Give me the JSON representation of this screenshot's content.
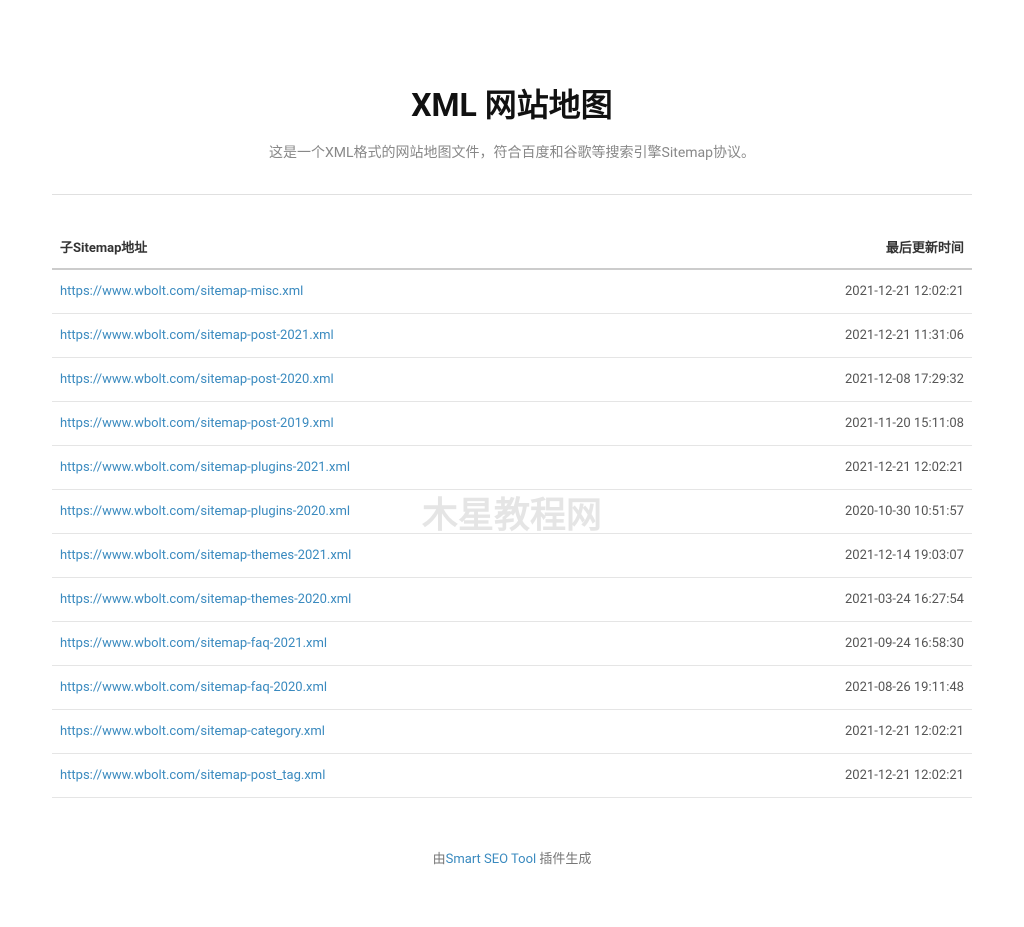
{
  "header": {
    "title": "XML 网站地图",
    "description": "这是一个XML格式的网站地图文件，符合百度和谷歌等搜索引擎Sitemap协议。"
  },
  "table": {
    "col_url_label": "子Sitemap地址",
    "col_date_label": "最后更新时间",
    "rows": [
      {
        "url": "https://www.wbolt.com/sitemap-misc.xml",
        "date": "2021-12-21 12:02:21"
      },
      {
        "url": "https://www.wbolt.com/sitemap-post-2021.xml",
        "date": "2021-12-21 11:31:06"
      },
      {
        "url": "https://www.wbolt.com/sitemap-post-2020.xml",
        "date": "2021-12-08 17:29:32"
      },
      {
        "url": "https://www.wbolt.com/sitemap-post-2019.xml",
        "date": "2021-11-20 15:11:08"
      },
      {
        "url": "https://www.wbolt.com/sitemap-plugins-2021.xml",
        "date": "2021-12-21 12:02:21"
      },
      {
        "url": "https://www.wbolt.com/sitemap-plugins-2020.xml",
        "date": "2020-10-30 10:51:57"
      },
      {
        "url": "https://www.wbolt.com/sitemap-themes-2021.xml",
        "date": "2021-12-14 19:03:07"
      },
      {
        "url": "https://www.wbolt.com/sitemap-themes-2020.xml",
        "date": "2021-03-24 16:27:54"
      },
      {
        "url": "https://www.wbolt.com/sitemap-faq-2021.xml",
        "date": "2021-09-24 16:58:30"
      },
      {
        "url": "https://www.wbolt.com/sitemap-faq-2020.xml",
        "date": "2021-08-26 19:11:48"
      },
      {
        "url": "https://www.wbolt.com/sitemap-category.xml",
        "date": "2021-12-21 12:02:21"
      },
      {
        "url": "https://www.wbolt.com/sitemap-post_tag.xml",
        "date": "2021-12-21 12:02:21"
      }
    ]
  },
  "watermark": {
    "text": "木星教程网"
  },
  "footer": {
    "prefix": "由",
    "link_text": "Smart SEO Tool",
    "suffix": " 插件生成"
  }
}
